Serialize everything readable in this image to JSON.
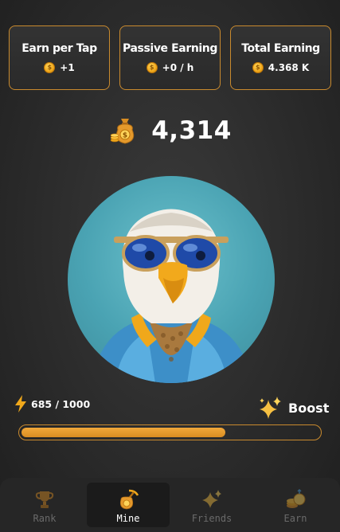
{
  "stats": [
    {
      "title": "Earn per Tap",
      "value": "+1",
      "icon": "coin-icon"
    },
    {
      "title": "Passive Earning",
      "value": "+0 / h",
      "icon": "coin-icon"
    },
    {
      "title": "Total Earning",
      "value": "4.368 K",
      "icon": "coin-icon"
    }
  ],
  "balance": {
    "value": "4,314",
    "icon": "money-bag-icon"
  },
  "avatar": {
    "icon": "eagle-with-sunglasses-avatar"
  },
  "energy": {
    "text": "685 / 1000",
    "current": 685,
    "max": 1000,
    "icon": "lightning-icon"
  },
  "boost": {
    "label": "Boost",
    "icon": "sparkles-icon"
  },
  "nav": [
    {
      "label": "Rank",
      "icon": "trophy-icon",
      "active": false
    },
    {
      "label": "Mine",
      "icon": "pickaxe-coin-icon",
      "active": true
    },
    {
      "label": "Friends",
      "icon": "sparkles-icon",
      "active": false
    },
    {
      "label": "Earn",
      "icon": "coin-stack-icon",
      "active": false
    }
  ],
  "colors": {
    "accent": "#e0972a",
    "border": "#c98a2e",
    "background": "#2b2b2b"
  }
}
